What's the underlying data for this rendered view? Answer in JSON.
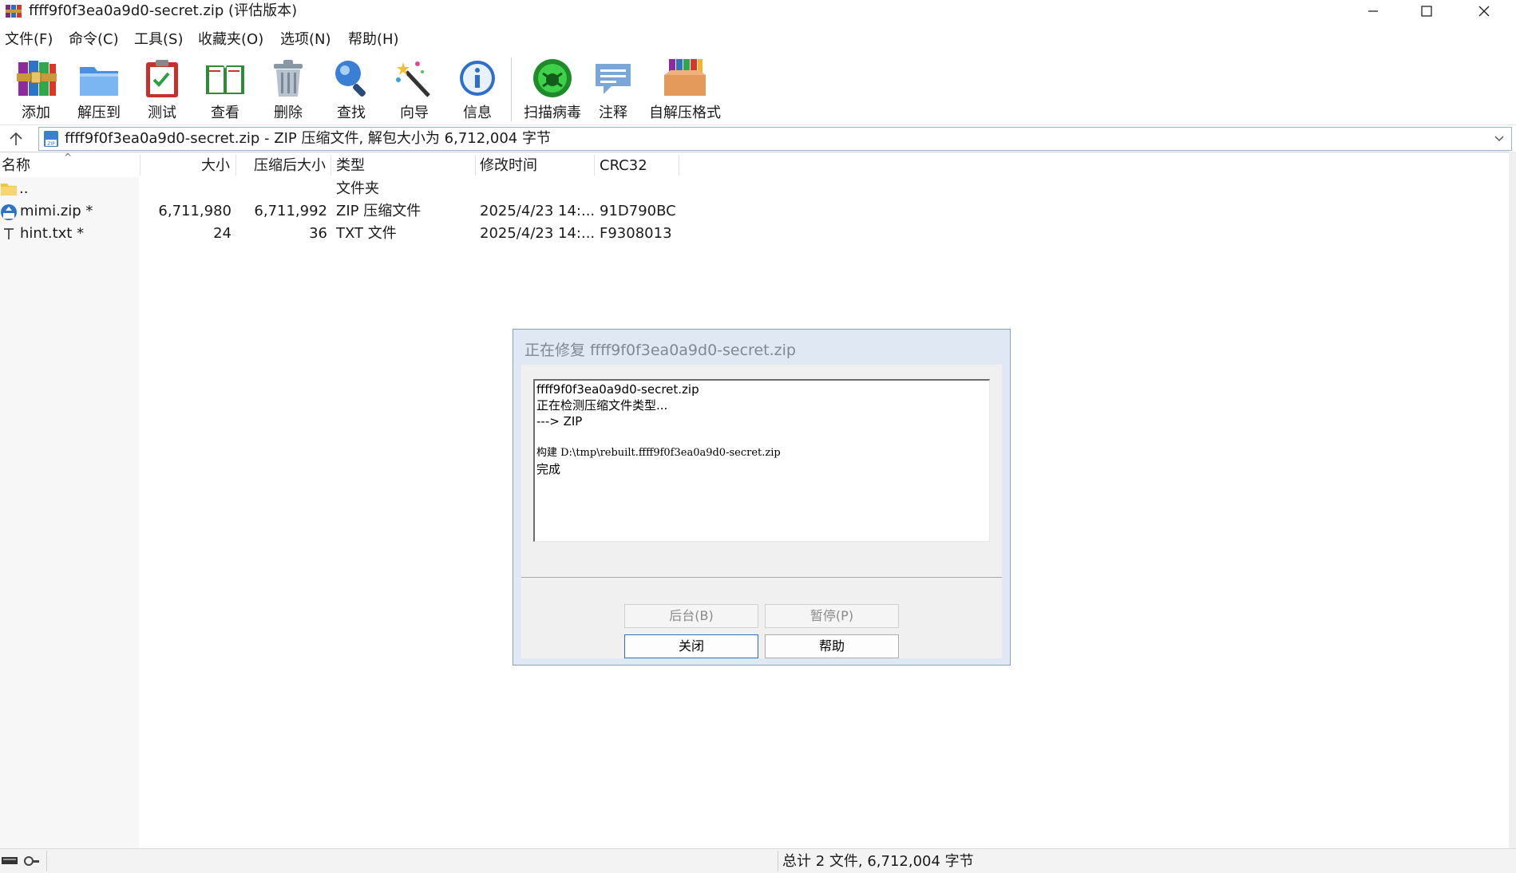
{
  "window": {
    "title": "ffff9f0f3ea0a9d0-secret.zip (评估版本)"
  },
  "menubar": {
    "items": [
      "文件(F)",
      "命令(C)",
      "工具(S)",
      "收藏夹(O)",
      "选项(N)",
      "帮助(H)"
    ]
  },
  "toolbar": {
    "items": [
      {
        "label": "添加",
        "icon": "books-add-icon"
      },
      {
        "label": "解压到",
        "icon": "folder-extract-icon"
      },
      {
        "label": "测试",
        "icon": "clipboard-check-icon"
      },
      {
        "label": "查看",
        "icon": "open-book-icon"
      },
      {
        "label": "删除",
        "icon": "trash-can-icon"
      },
      {
        "label": "查找",
        "icon": "magnifier-icon"
      },
      {
        "label": "向导",
        "icon": "magic-wand-icon"
      },
      {
        "label": "信息",
        "icon": "info-icon"
      },
      {
        "label": "扫描病毒",
        "icon": "virus-scan-icon"
      },
      {
        "label": "注释",
        "icon": "comment-icon"
      },
      {
        "label": "自解压格式",
        "icon": "sfx-box-icon"
      }
    ]
  },
  "address": {
    "text": "ffff9f0f3ea0a9d0-secret.zip - ZIP 压缩文件, 解包大小为 6,712,004 字节"
  },
  "columns": {
    "name": "名称",
    "size": "大小",
    "packed": "压缩后大小",
    "type": "类型",
    "modified": "修改时间",
    "crc": "CRC32"
  },
  "files": [
    {
      "name": "..",
      "size": "",
      "packed": "",
      "type": "文件夹",
      "modified": "",
      "crc": "",
      "icon": "folder-icon"
    },
    {
      "name": "mimi.zip *",
      "size": "6,711,980",
      "packed": "6,711,992",
      "type": "ZIP 压缩文件",
      "modified": "2025/4/23 14:...",
      "crc": "91D790BC",
      "icon": "zip-file-icon"
    },
    {
      "name": "hint.txt *",
      "size": "24",
      "packed": "36",
      "type": "TXT 文件",
      "modified": "2025/4/23 14:...",
      "crc": "F9308013",
      "icon": "text-file-icon"
    }
  ],
  "status": {
    "summary": "总计 2 文件, 6,712,004 字节"
  },
  "dialog": {
    "title": "正在修复 ffff9f0f3ea0a9d0-secret.zip",
    "log": [
      "ffff9f0f3ea0a9d0-secret.zip",
      "正在检测压缩文件类型...",
      "---> ZIP",
      "",
      "构建 D:\\tmp\\rebuilt.ffff9f0f3ea0a9d0-secret.zip",
      "完成"
    ],
    "buttons": {
      "background": "后台(B)",
      "pause": "暂停(P)",
      "close": "关闭",
      "help": "帮助"
    }
  }
}
